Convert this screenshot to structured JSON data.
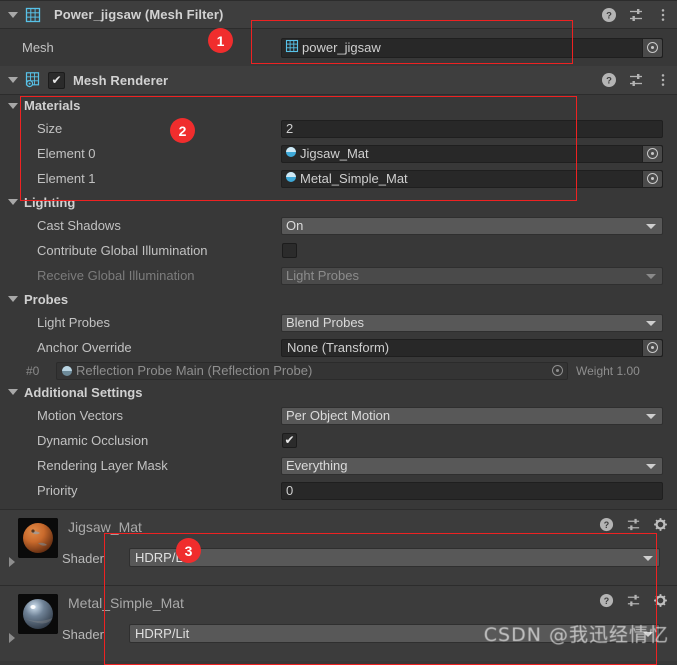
{
  "mesh_filter": {
    "title": "Power_jigsaw (Mesh Filter)",
    "icon": "mesh-filter-icon",
    "mesh_label": "Mesh",
    "mesh_value": "power_jigsaw"
  },
  "mesh_renderer": {
    "title": "Mesh Renderer",
    "icon": "mesh-renderer-icon",
    "enabled": true,
    "materials": {
      "header": "Materials",
      "size_label": "Size",
      "size_value": "2",
      "elements": [
        {
          "label": "Element 0",
          "value": "Jigsaw_Mat"
        },
        {
          "label": "Element 1",
          "value": "Metal_Simple_Mat"
        }
      ]
    },
    "lighting": {
      "header": "Lighting",
      "cast_shadows_label": "Cast Shadows",
      "cast_shadows_value": "On",
      "contribute_gi_label": "Contribute Global Illumination",
      "contribute_gi_checked": false,
      "receive_gi_label": "Receive Global Illumination",
      "receive_gi_value": "Light Probes"
    },
    "probes": {
      "header": "Probes",
      "light_probes_label": "Light Probes",
      "light_probes_value": "Blend Probes",
      "anchor_override_label": "Anchor Override",
      "anchor_override_value": "None (Transform)",
      "reflection_index": "#0",
      "reflection_value": "Reflection Probe Main (Reflection Probe)",
      "reflection_weight": "Weight 1.00"
    },
    "additional_settings": {
      "header": "Additional Settings",
      "motion_vectors_label": "Motion Vectors",
      "motion_vectors_value": "Per Object Motion",
      "dynamic_occlusion_label": "Dynamic Occlusion",
      "dynamic_occlusion_checked": true,
      "rendering_layer_mask_label": "Rendering Layer Mask",
      "rendering_layer_mask_value": "Everything",
      "priority_label": "Priority",
      "priority_value": "0"
    }
  },
  "material_previews": [
    {
      "name": "Jigsaw_Mat",
      "shader_label": "Shader",
      "shader_value": "HDRP/Lit"
    },
    {
      "name": "Metal_Simple_Mat",
      "shader_label": "Shader",
      "shader_value": "HDRP/Lit"
    }
  ],
  "annotations": {
    "badges": [
      "1",
      "2",
      "3"
    ],
    "box_color": "#ee2222",
    "badge_color": "#f02d2d"
  },
  "watermark": "CSDN @我迅经情忆"
}
